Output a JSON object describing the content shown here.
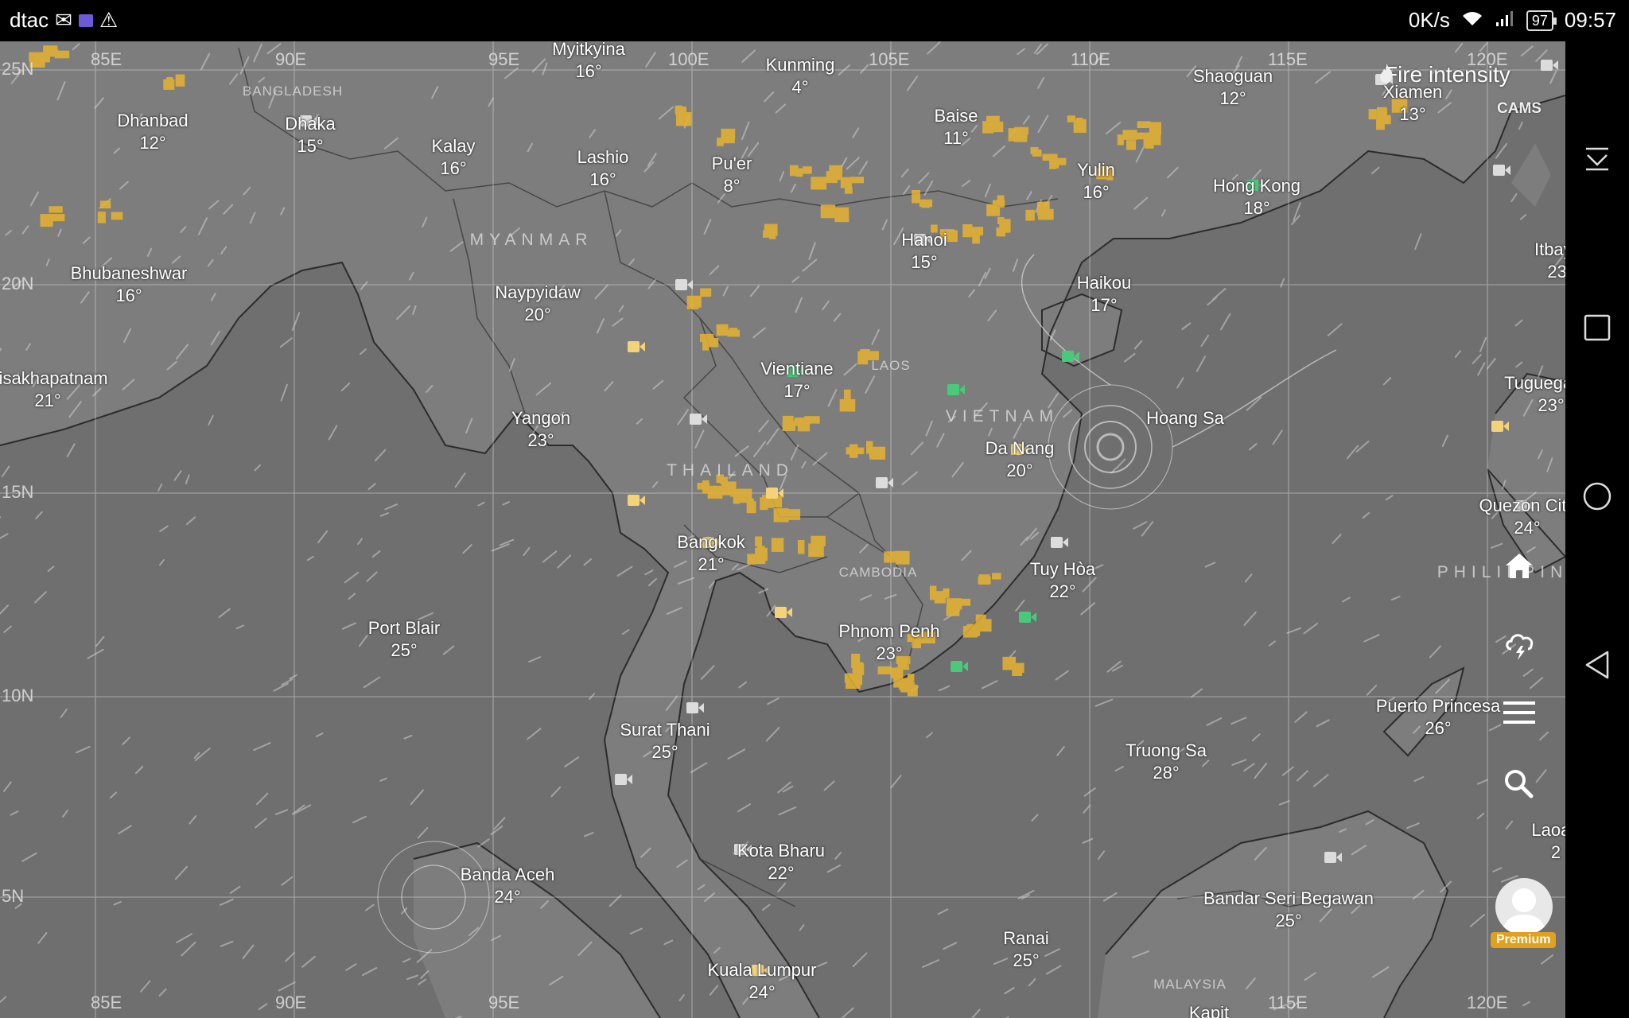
{
  "status_bar": {
    "carrier": "dtac",
    "speed": "0K/s",
    "battery": "97",
    "time": "09:57"
  },
  "map": {
    "layer_title": "Fire intensity",
    "source": "CAMS",
    "grid_labels": {
      "lon": [
        "85E",
        "90E",
        "95E",
        "100E",
        "105E",
        "110E",
        "115E",
        "120E"
      ],
      "lat": [
        "25N",
        "20N",
        "15N",
        "10N",
        "5N"
      ]
    },
    "countries": [
      {
        "name": "BANGLADESH"
      },
      {
        "name": "MYANMAR"
      },
      {
        "name": "LAOS"
      },
      {
        "name": "THAILAND"
      },
      {
        "name": "VIETNAM"
      },
      {
        "name": "CAMBODIA"
      },
      {
        "name": "MALAYSIA"
      },
      {
        "name": "PHILIPPINES"
      }
    ],
    "cities": [
      {
        "name": "Myitkyina",
        "temp": "16°"
      },
      {
        "name": "Kunming",
        "temp": "4°"
      },
      {
        "name": "Shaoguan",
        "temp": "12°"
      },
      {
        "name": "Xiamen",
        "temp": "13°"
      },
      {
        "name": "Dhanbad",
        "temp": "12°"
      },
      {
        "name": "Dhaka",
        "temp": "15°"
      },
      {
        "name": "Kalay",
        "temp": "16°"
      },
      {
        "name": "Lashio",
        "temp": "16°"
      },
      {
        "name": "Pu'er",
        "temp": "8°"
      },
      {
        "name": "Baise",
        "temp": "11°"
      },
      {
        "name": "Yulin",
        "temp": "16°"
      },
      {
        "name": "Hong Kong",
        "temp": "18°"
      },
      {
        "name": "Bhubaneshwar",
        "temp": "16°"
      },
      {
        "name": "Naypyidaw",
        "temp": "20°"
      },
      {
        "name": "Hanoi",
        "temp": "15°"
      },
      {
        "name": "Haikou",
        "temp": "17°"
      },
      {
        "name": "Visakhapatnam",
        "temp": "21°"
      },
      {
        "name": "Vientiane",
        "temp": "17°"
      },
      {
        "name": "Yangon",
        "temp": "23°"
      },
      {
        "name": "Hoang Sa",
        "temp": ""
      },
      {
        "name": "Da Nang",
        "temp": "20°"
      },
      {
        "name": "Bangkok",
        "temp": "21°"
      },
      {
        "name": "Tuy Hòa",
        "temp": "22°"
      },
      {
        "name": "Port Blair",
        "temp": "25°"
      },
      {
        "name": "Phnom Penh",
        "temp": "23°"
      },
      {
        "name": "Surat Thani",
        "temp": "25°"
      },
      {
        "name": "Truong Sa",
        "temp": "28°"
      },
      {
        "name": "Puerto Princesa",
        "temp": "26°"
      },
      {
        "name": "Kota Bharu",
        "temp": "22°"
      },
      {
        "name": "Banda Aceh",
        "temp": "24°"
      },
      {
        "name": "Bandar Seri Begawan",
        "temp": "25°"
      },
      {
        "name": "Ranai",
        "temp": "25°"
      },
      {
        "name": "Kuala Lumpur",
        "temp": "24°"
      },
      {
        "name": "Kapit",
        "temp": ""
      },
      {
        "name": "Itbayat",
        "temp": "23°"
      },
      {
        "name": "Tuguegarao",
        "temp": "23°"
      },
      {
        "name": "Quezon City",
        "temp": "24°"
      },
      {
        "name": "Laoag",
        "temp": "2"
      }
    ]
  },
  "side_buttons": {
    "home": "home-icon",
    "weather": "storm-icon",
    "menu": "menu-icon",
    "search": "search-icon",
    "premium_label": "Premium"
  },
  "colors": {
    "map_bg": "#6f6f6f",
    "fire": "#e6b230",
    "cam_default": "#dcdcdc",
    "cam_fire": "#f3d27a",
    "cam_green": "#49c97a"
  }
}
